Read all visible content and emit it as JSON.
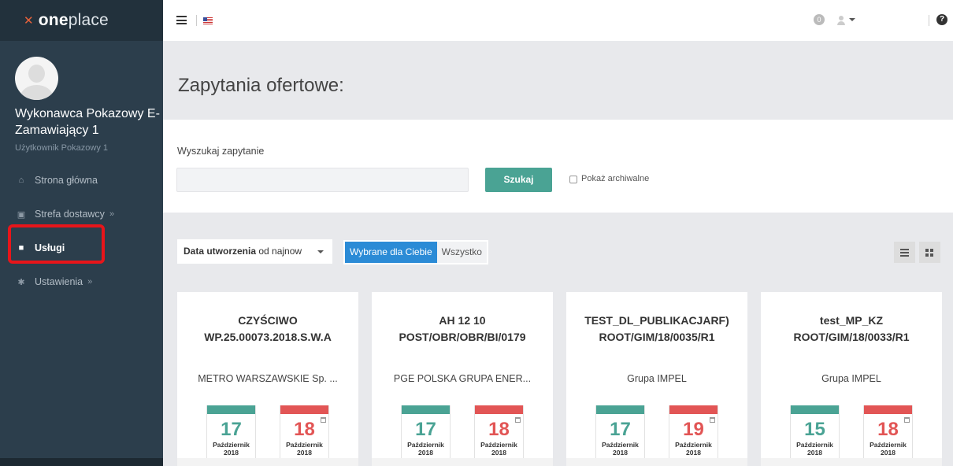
{
  "brand": {
    "logo_mark": "✕",
    "name_bold": "one",
    "name_light": "place"
  },
  "user": {
    "display_name": "Wykonawca Pokazowy E-Zamawiający 1",
    "subtitle": "Użytkownik Pokazowy 1"
  },
  "sidebar": {
    "items": [
      {
        "label": "Strona główna",
        "icon": "home-icon"
      },
      {
        "label": "Strefa dostawcy",
        "icon": "card-icon",
        "chevron": "»"
      },
      {
        "label": "Usługi",
        "icon": "grid-icon",
        "active": true
      },
      {
        "label": "Ustawienia",
        "icon": "gear-icon",
        "chevron": "»"
      }
    ]
  },
  "topbar": {
    "notification_count": "0",
    "help_label": "?"
  },
  "page": {
    "title": "Zapytania ofertowe:"
  },
  "search": {
    "label": "Wyszukaj zapytanie",
    "value": "",
    "button_label": "Szukaj",
    "archive_label": "Pokaż archiwalne"
  },
  "filters": {
    "sort_bold": "Data utworzenia",
    "sort_rest": " od najnow",
    "toggle_selected": "Wybrane dla Ciebie",
    "toggle_all": "Wszystko"
  },
  "cards": [
    {
      "title": "CZYŚCIWO",
      "number": "WP.25.00073.2018.S.W.A",
      "buyer": "METRO WARSZAWSKIE Sp. ...",
      "start_day": "17",
      "start_month": "Październik",
      "start_year": "2018",
      "end_day": "18",
      "end_month": "Październik",
      "end_year": "2018"
    },
    {
      "title": "AH 12 10",
      "number": "POST/OBR/OBR/BI/0179",
      "buyer": "PGE POLSKA GRUPA ENER...",
      "start_day": "17",
      "start_month": "Październik",
      "start_year": "2018",
      "end_day": "18",
      "end_month": "Październik",
      "end_year": "2018"
    },
    {
      "title": "TEST_DL_PUBLIKACJARF)",
      "number": "ROOT/GIM/18/0035/R1",
      "buyer": "Grupa IMPEL",
      "start_day": "17",
      "start_month": "Październik",
      "start_year": "2018",
      "end_day": "19",
      "end_month": "Październik",
      "end_year": "2018"
    },
    {
      "title": "test_MP_KZ",
      "number": "ROOT/GIM/18/0033/R1",
      "buyer": "Grupa IMPEL",
      "start_day": "15",
      "start_month": "Październik",
      "start_year": "2018",
      "end_day": "18",
      "end_month": "Październik",
      "end_year": "2018"
    }
  ],
  "colors": {
    "sidebar": "#2c3e4c",
    "accent_green": "#4aa394",
    "accent_red": "#e25555",
    "accent_blue": "#2b8bd6",
    "highlight": "#e8151a"
  }
}
